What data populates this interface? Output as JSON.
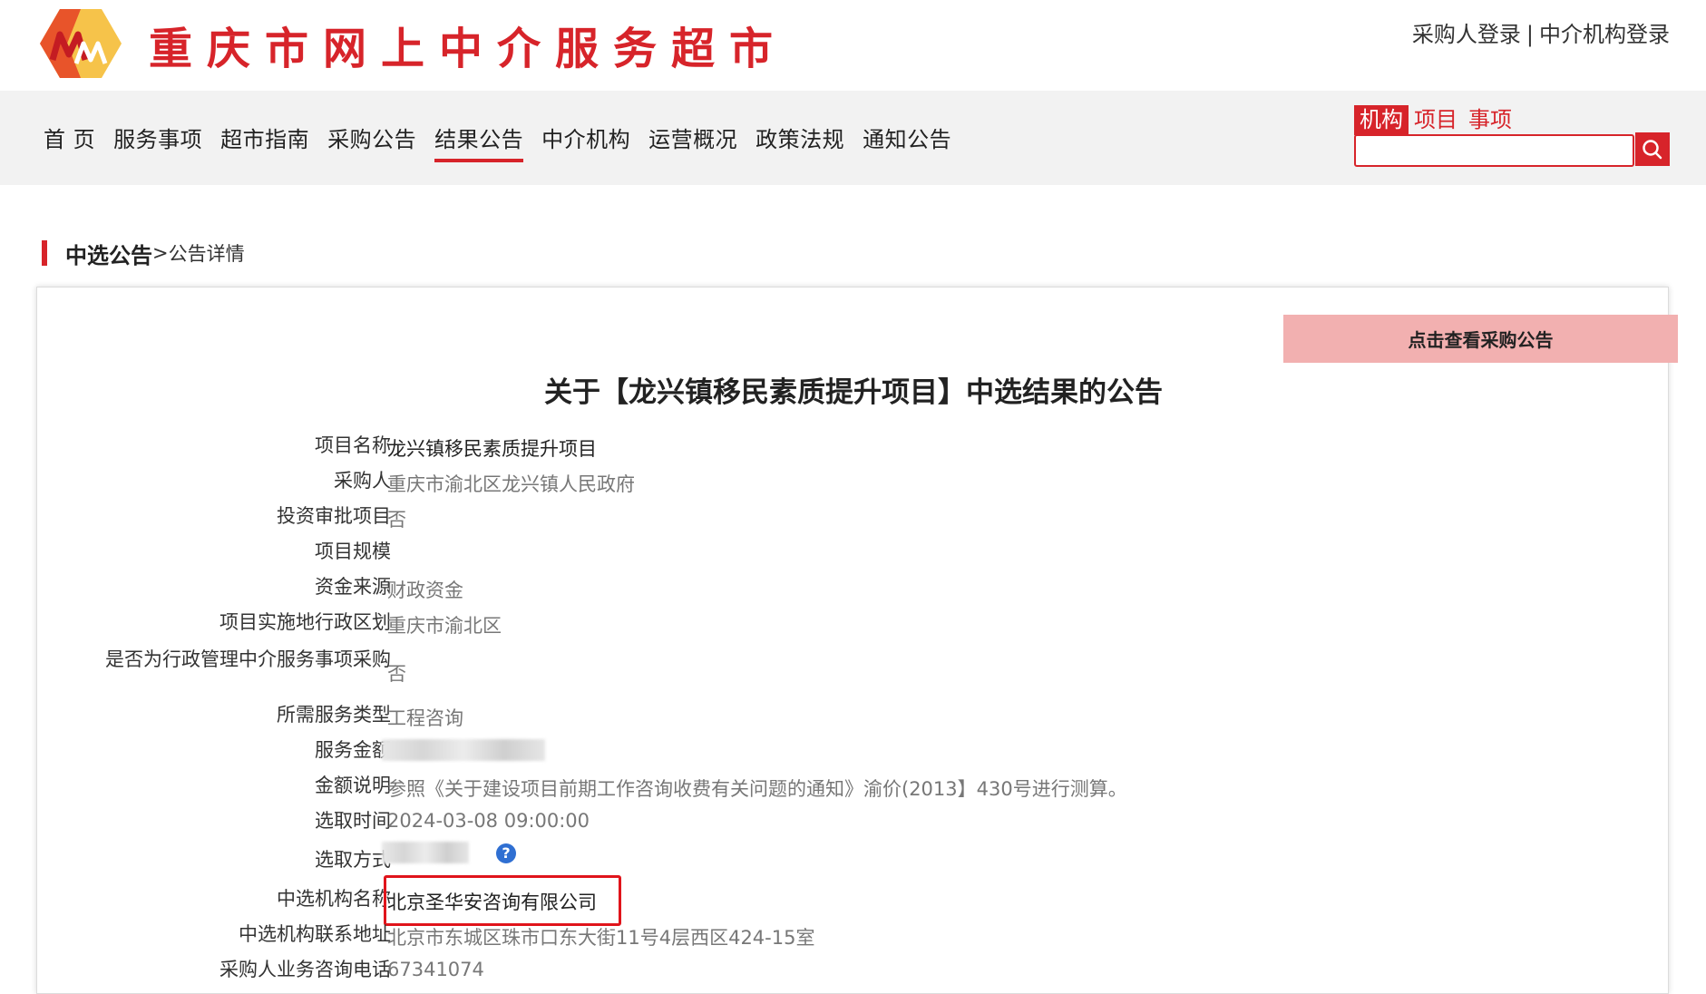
{
  "site": {
    "title": "重庆市网上中介服务超市",
    "login_buyer": "采购人登录",
    "login_separator": "|",
    "login_agency": "中介机构登录",
    "logo_icon": "site-logo"
  },
  "nav": {
    "items": [
      "首 页",
      "服务事项",
      "超市指南",
      "采购公告",
      "结果公告",
      "中介机构",
      "运营概况",
      "政策法规",
      "通知公告"
    ],
    "active": "结果公告"
  },
  "search": {
    "tabs": [
      "机构",
      "项目",
      "事项"
    ],
    "active_tab": "机构",
    "placeholder": "",
    "button_icon": "search-icon"
  },
  "breadcrumb": {
    "main": "中选公告",
    "separator": ">",
    "sub": "公告详情"
  },
  "notice": {
    "view_button": "点击查看采购公告",
    "title": "关于【龙兴镇移民素质提升项目】中选结果的公告",
    "fields": [
      {
        "label": "项目名称",
        "value": "龙兴镇移民素质提升项目"
      },
      {
        "label": "采购人",
        "value": "重庆市渝北区龙兴镇人民政府"
      },
      {
        "label": "投资审批项目",
        "value": "否"
      },
      {
        "label": "项目规模",
        "value": ""
      },
      {
        "label": "资金来源",
        "value": "财政资金"
      },
      {
        "label": "项目实施地行政区划",
        "value": "重庆市渝北区"
      },
      {
        "label": "是否为行政管理中介服务事项采购",
        "value": "否"
      },
      {
        "label": "所需服务类型",
        "value": "工程咨询"
      },
      {
        "label": "服务金额",
        "value": ""
      },
      {
        "label": "金额说明",
        "value": "参照《关于建设项目前期工作咨询收费有关问题的通知》渝价(2013】430号进行测算。"
      },
      {
        "label": "选取时间",
        "value": "2024-03-08 09:00:00"
      },
      {
        "label": "选取方式",
        "value": ""
      },
      {
        "label": "中选机构名称",
        "value": "北京圣华安咨询有限公司"
      },
      {
        "label": "中选机构联系地址",
        "value": "北京市东城区珠市口东大街11号4层西区424-15室"
      },
      {
        "label": "采购人业务咨询电话",
        "value": "67341074"
      }
    ]
  },
  "colors": {
    "brand_red": "#d7242a",
    "button_pink": "#f2b0b0",
    "help_blue": "#2f6fd2"
  }
}
